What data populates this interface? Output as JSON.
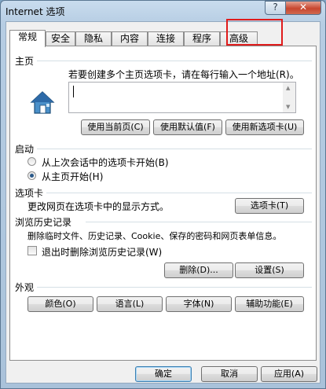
{
  "window": {
    "title": "Internet 选项",
    "help_glyph": "?",
    "close_glyph": "✕"
  },
  "tabs": [
    "常规",
    "安全",
    "隐私",
    "内容",
    "连接",
    "程序",
    "高级"
  ],
  "home": {
    "group_label": "主页",
    "description": "若要创建多个主页选项卡，请在每行输入一个地址(R)。",
    "url_value": "",
    "buttons": [
      "使用当前页(C)",
      "使用默认值(F)",
      "使用新选项卡(U)"
    ]
  },
  "startup": {
    "group_label": "启动",
    "options": [
      "从上次会话中的选项卡开始(B)",
      "从主页开始(H)"
    ],
    "selected_index": 1
  },
  "tabs_group": {
    "group_label": "选项卡",
    "description": "更改网页在选项卡中的显示方式。",
    "button": "选项卡(T)"
  },
  "history": {
    "group_label": "浏览历史记录",
    "description": "删除临时文件、历史记录、Cookie、保存的密码和网页表单信息。",
    "checkbox_label": "退出时删除浏览历史记录(W)",
    "checkbox_checked": false,
    "delete_button": "删除(D)...",
    "settings_button": "设置(S)"
  },
  "appearance": {
    "group_label": "外观",
    "buttons": [
      "颜色(O)",
      "语言(L)",
      "字体(N)",
      "辅助功能(E)"
    ]
  },
  "footer": {
    "ok": "确定",
    "cancel": "取消",
    "apply": "应用(A)"
  },
  "colors": {
    "highlight": "#e01b1b"
  }
}
